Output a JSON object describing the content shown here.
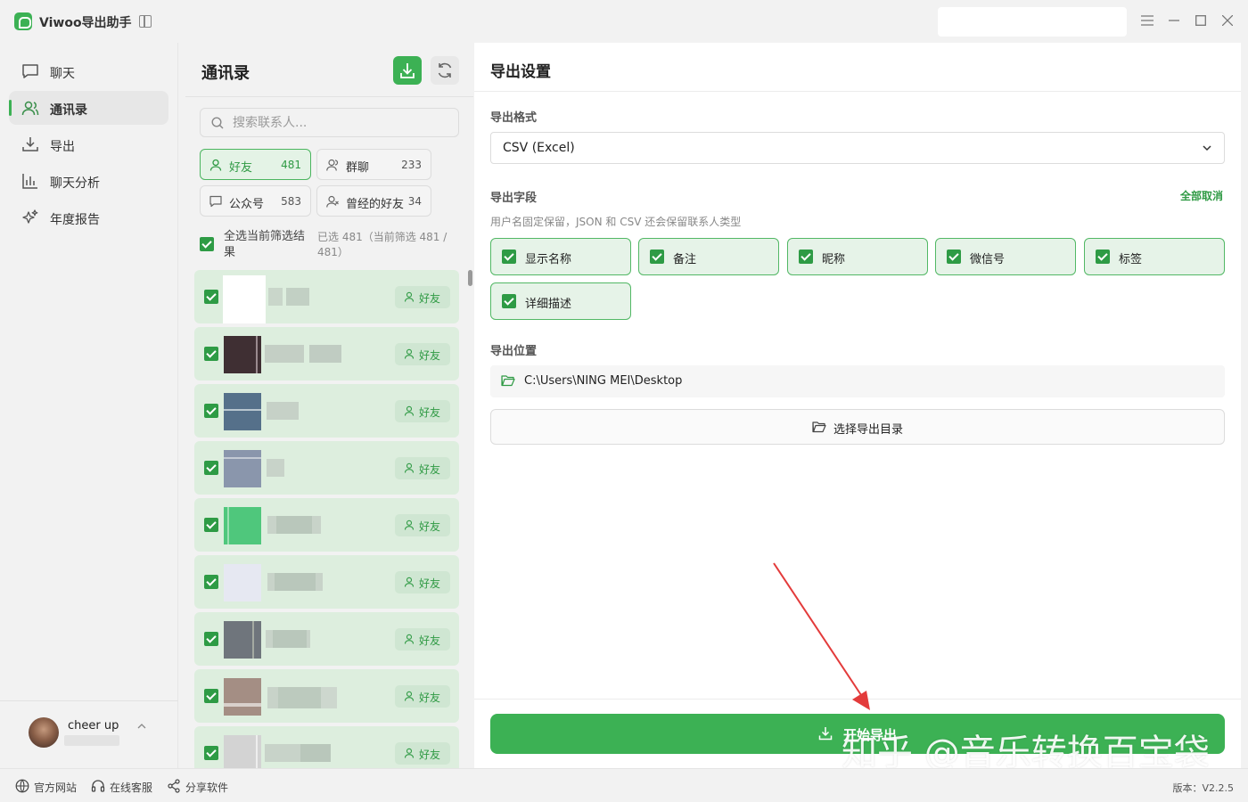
{
  "app": {
    "title": "Viwoo导出助手"
  },
  "sidebar": {
    "items": [
      {
        "label": "聊天",
        "icon": "chat-icon",
        "active": false
      },
      {
        "label": "通讯录",
        "icon": "contacts-icon",
        "active": true
      },
      {
        "label": "导出",
        "icon": "download-icon",
        "active": false
      },
      {
        "label": "聊天分析",
        "icon": "bar-chart-icon",
        "active": false
      },
      {
        "label": "年度报告",
        "icon": "sparkle-icon",
        "active": false
      }
    ],
    "user": {
      "name": "cheer up"
    }
  },
  "contacts": {
    "title": "通讯录",
    "search_placeholder": "搜索联系人...",
    "filters": [
      {
        "label": "好友",
        "count": "481",
        "active": true,
        "icon": "user-icon"
      },
      {
        "label": "群聊",
        "count": "233",
        "active": false,
        "icon": "group-icon"
      },
      {
        "label": "公众号",
        "count": "583",
        "active": false,
        "icon": "message-icon"
      },
      {
        "label": "曾经的好友",
        "count": "34",
        "active": false,
        "icon": "user-x-icon"
      }
    ],
    "select_all_label": "全选当前筛选结果",
    "select_info": "已选 481（当前筛选 481 / 481）",
    "rows": [
      {
        "tag": "好友"
      },
      {
        "tag": "好友"
      },
      {
        "tag": "好友"
      },
      {
        "tag": "好友"
      },
      {
        "tag": "好友"
      },
      {
        "tag": "好友"
      },
      {
        "tag": "好友"
      },
      {
        "tag": "好友"
      },
      {
        "tag": "好友"
      }
    ]
  },
  "settings": {
    "title": "导出设置",
    "format_label": "导出格式",
    "format_value": "CSV (Excel)",
    "fields_label": "导出字段",
    "deselect_all": "全部取消",
    "fields_hint": "用户名固定保留，JSON 和 CSV 还会保留联系人类型",
    "fields": [
      "显示名称",
      "备注",
      "昵称",
      "微信号",
      "标签",
      "详细描述"
    ],
    "location_label": "导出位置",
    "path": "C:\\Users\\NING MEI\\Desktop",
    "choose_dir": "选择导出目录",
    "start": "开始导出"
  },
  "footer": {
    "links": [
      "官方网站",
      "在线客服",
      "分享软件"
    ],
    "version": "版本：V2.2.5"
  },
  "watermark": "知乎 @音乐转换百宝袋",
  "colors": {
    "accent": "#3cb154",
    "chip_bg": "#e6f3e8",
    "row_bg": "#ddeede"
  }
}
